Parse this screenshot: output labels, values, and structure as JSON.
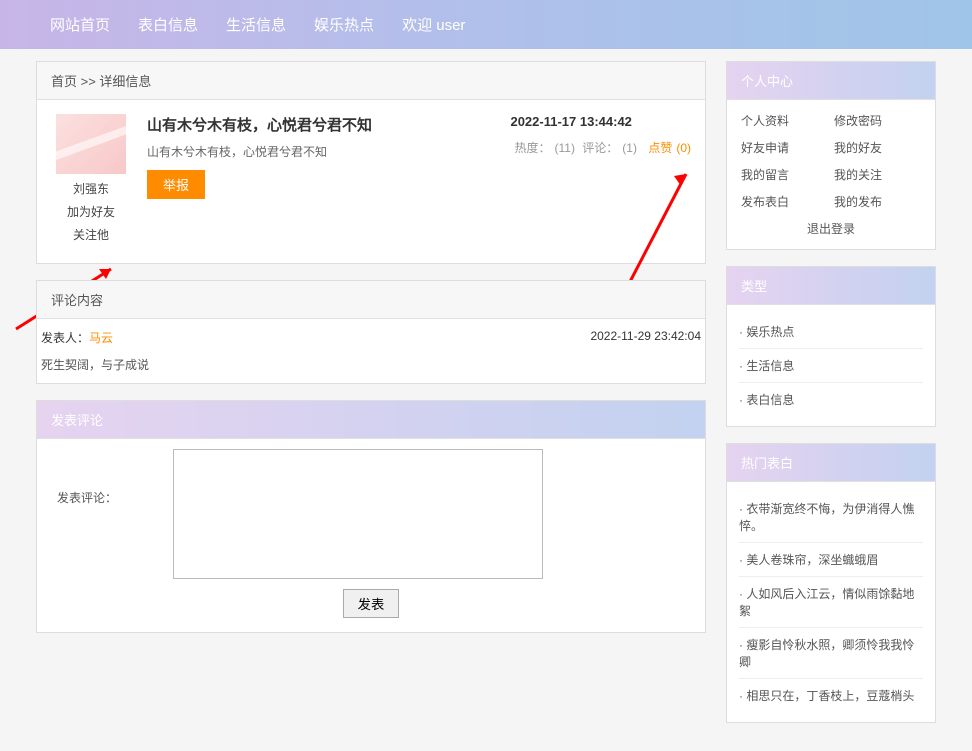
{
  "nav": {
    "home": "网站首页",
    "confession": "表白信息",
    "life": "生活信息",
    "entertainment": "娱乐热点",
    "welcome": "欢迎 user"
  },
  "breadcrumb": "首页 >> 详细信息",
  "post": {
    "author": "刘强东",
    "add_friend": "加为好友",
    "follow": "关注他",
    "title": "山有木兮木有枝，心悦君兮君不知",
    "subtitle": "山有木兮木有枝，心悦君兮君不知",
    "report_btn": "举报",
    "date": "2022-11-17 13:44:42",
    "stats": {
      "heat_label": "热度：",
      "heat": "(11)",
      "comment_label": "评论：",
      "comment": "(1)",
      "like_label": "点赞",
      "like": "(0)"
    }
  },
  "comments": {
    "header": "评论内容",
    "author_prefix": "发表人：",
    "author": "马云",
    "date": "2022-11-29 23:42:04",
    "text": "死生契阔，与子成说"
  },
  "form": {
    "header": "发表评论",
    "label": "发表评论：",
    "submit": "发表"
  },
  "center": {
    "header": "个人中心",
    "items": {
      "profile": "个人资料",
      "password": "修改密码",
      "friend_req": "好友申请",
      "my_friends": "我的好友",
      "my_msg": "我的留言",
      "my_follow": "我的关注",
      "publish": "发布表白",
      "my_publish": "我的发布",
      "logout": "退出登录"
    }
  },
  "types": {
    "header": "类型",
    "items": [
      "娱乐热点",
      "生活信息",
      "表白信息"
    ]
  },
  "hot": {
    "header": "热门表白",
    "items": [
      "衣带渐宽终不悔，为伊消得人憔悴。",
      "美人卷珠帘，深坐蟙蛾眉",
      "人如风后入江云，情似雨馀黏地絮",
      "瘦影自怜秋水照，卿须怜我我怜卿",
      "相思只在，丁香枝上，豆蔻梢头"
    ]
  }
}
